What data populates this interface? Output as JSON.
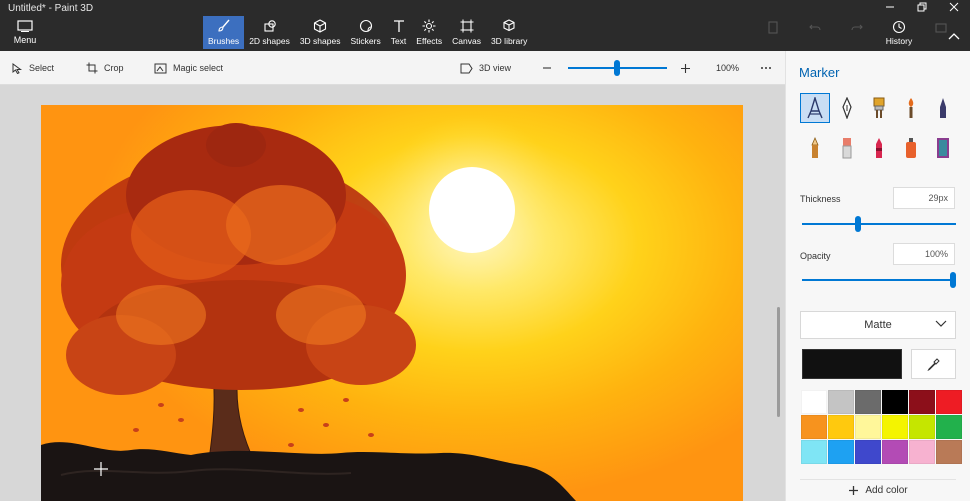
{
  "window": {
    "title": "Untitled* - Paint 3D"
  },
  "menu": {
    "label": "Menu"
  },
  "ribbon": {
    "tools": [
      {
        "label": "Brushes",
        "icon": "brush-icon"
      },
      {
        "label": "2D shapes",
        "icon": "2d-shapes-icon"
      },
      {
        "label": "3D shapes",
        "icon": "3d-shapes-icon"
      },
      {
        "label": "Stickers",
        "icon": "stickers-icon"
      },
      {
        "label": "Text",
        "icon": "text-icon"
      },
      {
        "label": "Effects",
        "icon": "effects-icon"
      },
      {
        "label": "Canvas",
        "icon": "canvas-icon"
      },
      {
        "label": "3D library",
        "icon": "3d-library-icon"
      }
    ],
    "active_tool": "Brushes",
    "right": {
      "history_label": "History"
    }
  },
  "toolbar": {
    "select_label": "Select",
    "crop_label": "Crop",
    "magic_select_label": "Magic select",
    "view3d_label": "3D view",
    "zoom_value": "100%",
    "zoom_fraction": 0.5
  },
  "panel": {
    "title": "Marker",
    "brushes": [
      {
        "name": "marker",
        "color": "#2b3a6b",
        "active": true
      },
      {
        "name": "calligraphy-pen",
        "color": "#333333"
      },
      {
        "name": "oil-brush",
        "color": "#e0a42b"
      },
      {
        "name": "watercolor",
        "color": "#e46b1c"
      },
      {
        "name": "pixel-pen",
        "color": "#3b3b6b"
      },
      {
        "name": "pencil",
        "color": "#c8822f"
      },
      {
        "name": "eraser",
        "color": "#e87d6a"
      },
      {
        "name": "crayon",
        "color": "#d8264f"
      },
      {
        "name": "spray-can",
        "color": "#e8612c"
      },
      {
        "name": "fill",
        "color": "#8a3d8f"
      }
    ],
    "thickness_label": "Thickness",
    "thickness_value": "29px",
    "thickness_fraction": 0.3,
    "opacity_label": "Opacity",
    "opacity_value": "100%",
    "opacity_fraction": 1.0,
    "finish_value": "Matte",
    "current_color": "#111111",
    "palette": [
      "#ffffff",
      "#c4c4c4",
      "#6b6b6b",
      "#000000",
      "#8c0f1a",
      "#ee1c24",
      "#f7931e",
      "#ffc90e",
      "#fff79a",
      "#f4f400",
      "#c5e600",
      "#22b14c",
      "#7fe5f5",
      "#1ea1f2",
      "#3f48cc",
      "#b34bb5",
      "#f7b2d0",
      "#b97a57"
    ],
    "add_color_label": "Add color"
  }
}
